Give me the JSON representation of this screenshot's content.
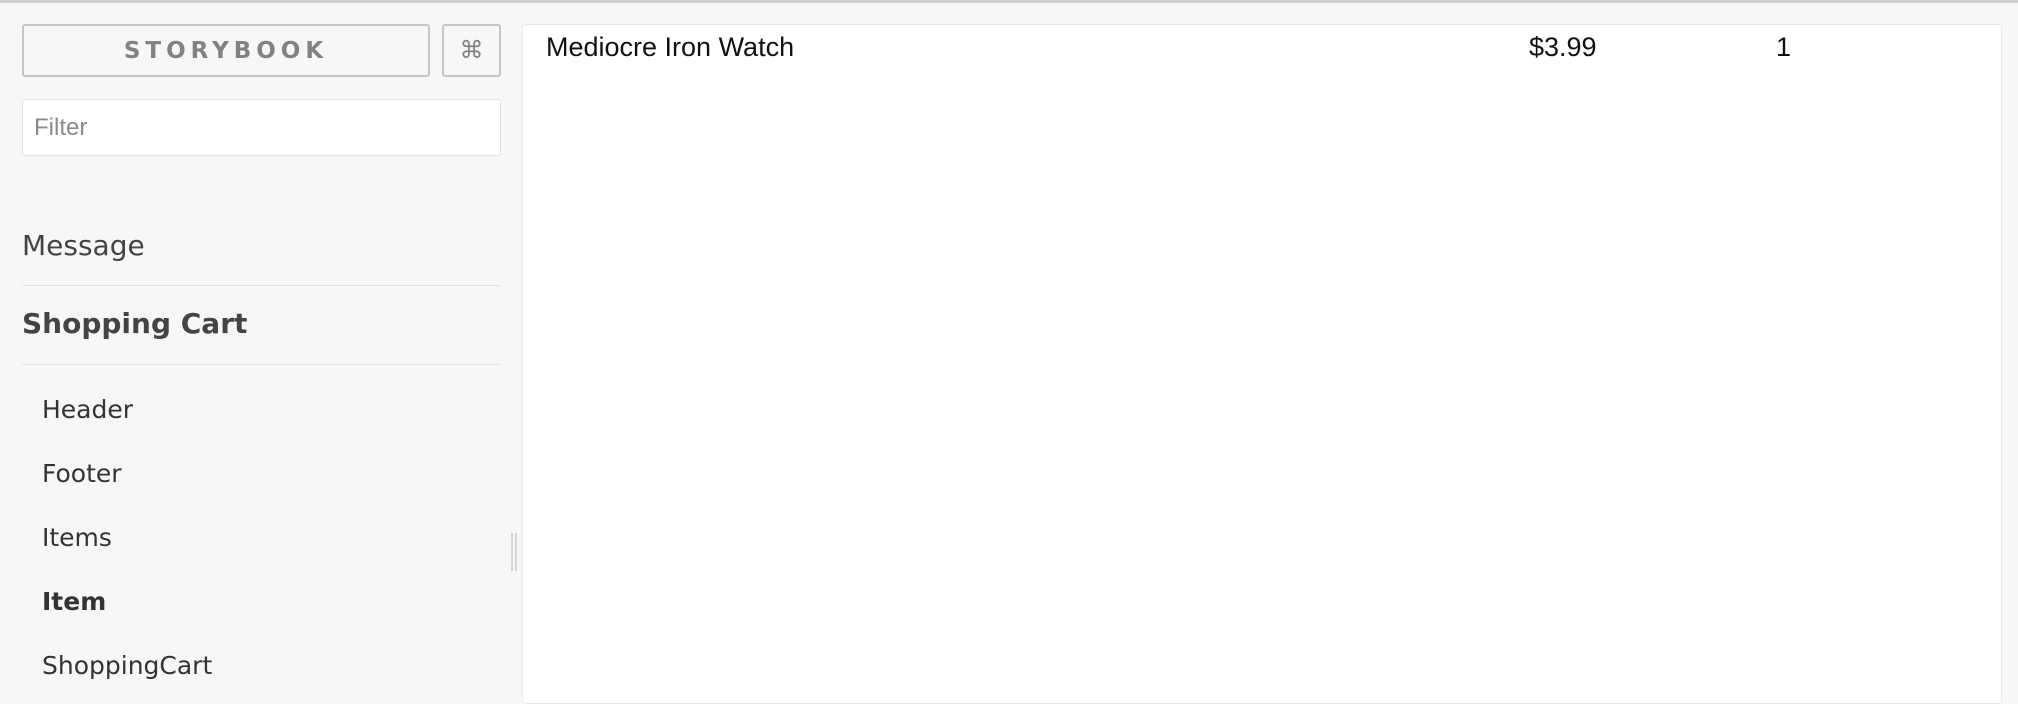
{
  "sidebar": {
    "brand_label": "STORYBOOK",
    "shortcut_label": "⌘",
    "filter_placeholder": "Filter",
    "filter_value": "",
    "kinds": [
      {
        "label": "Message"
      },
      {
        "label": "Shopping Cart",
        "stories": [
          {
            "label": "Header"
          },
          {
            "label": "Footer"
          },
          {
            "label": "Items"
          },
          {
            "label": "Item"
          },
          {
            "label": "ShoppingCart"
          }
        ]
      }
    ]
  },
  "preview": {
    "item": {
      "name": "Mediocre Iron Watch",
      "price": "$3.99",
      "quantity": "1"
    }
  }
}
